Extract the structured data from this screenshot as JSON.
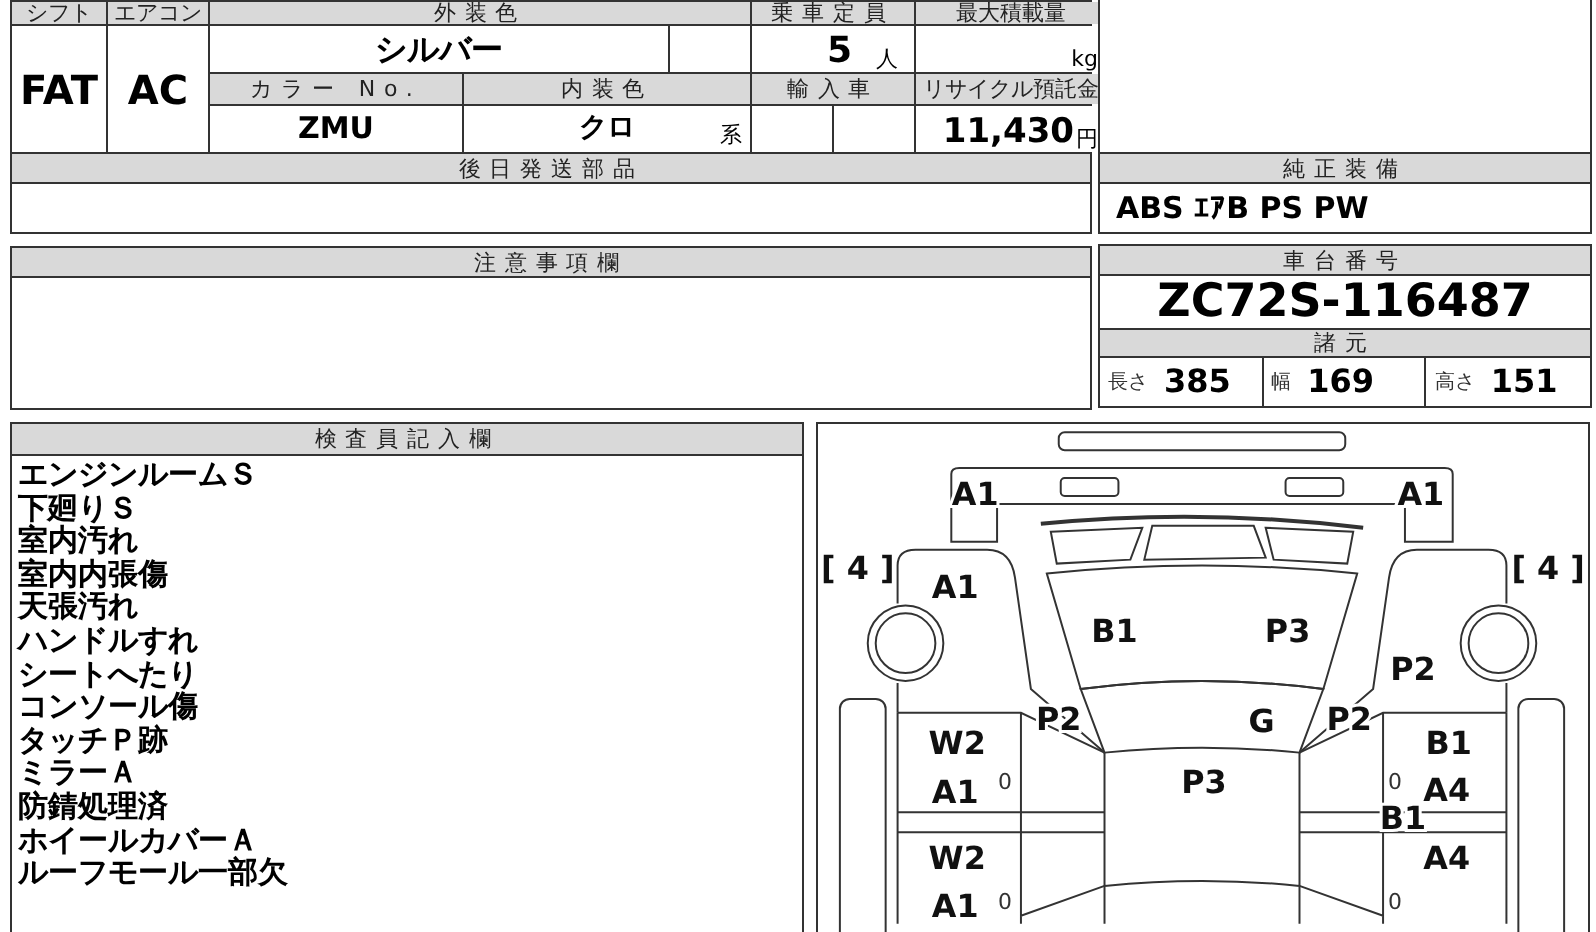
{
  "vehicle_table": {
    "shift": {
      "label": "シフト",
      "value": "FAT"
    },
    "aircon": {
      "label": "エアコン",
      "value": "AC"
    },
    "exterior_color": {
      "label": "外装色",
      "value": "シルバー"
    },
    "capacity": {
      "label": "乗車定員",
      "value": "5",
      "unit": "人"
    },
    "max_load": {
      "label": "最大積載量",
      "unit": "kg"
    },
    "color_no": {
      "label": "カラー No.",
      "value": "ZMU"
    },
    "interior_color": {
      "label": "内装色",
      "value": "クロ",
      "unit": "系"
    },
    "import": {
      "label": "輸入車"
    },
    "recycle_fee": {
      "label": "リサイクル預託金",
      "value": "11,430",
      "unit": "円"
    }
  },
  "later_parts": {
    "title": "後日発送部品"
  },
  "notes": {
    "title": "注意事項欄"
  },
  "equipment": {
    "title": "純正装備",
    "value": "ABS ｴｱB PS PW"
  },
  "chassis": {
    "title": "車台番号",
    "value": "ZC72S-116487"
  },
  "specs": {
    "title": "諸元",
    "items": [
      {
        "label": "長さ",
        "value": "385"
      },
      {
        "label": "幅",
        "value": "169"
      },
      {
        "label": "高さ",
        "value": "151"
      }
    ]
  },
  "inspector": {
    "title": "検査員記入欄",
    "lines": [
      "エンジンルームＳ",
      "下廻りＳ",
      "室内汚れ",
      "室内内張傷",
      "天張汚れ",
      "ハンドルすれ",
      "シートへたり",
      "コンソール傷",
      "タッチＰ跡",
      "ミラーＡ",
      "防錆処理済",
      "ホイールカバーＡ",
      "ルーフモール一部欠"
    ]
  },
  "damage_diagram": {
    "labels": [
      {
        "text": "A1",
        "kind": "code"
      },
      {
        "text": "A1",
        "kind": "code"
      },
      {
        "text": "[ 4 ]",
        "kind": "code"
      },
      {
        "text": "[ 4 ]",
        "kind": "code"
      },
      {
        "text": "A1",
        "kind": "code"
      },
      {
        "text": "B1",
        "kind": "code"
      },
      {
        "text": "P3",
        "kind": "code"
      },
      {
        "text": "P2",
        "kind": "code"
      },
      {
        "text": "P2",
        "kind": "code"
      },
      {
        "text": "G",
        "kind": "code"
      },
      {
        "text": "P2",
        "kind": "code"
      },
      {
        "text": "W2",
        "kind": "code"
      },
      {
        "text": "B1",
        "kind": "code"
      },
      {
        "text": "A1",
        "kind": "code"
      },
      {
        "text": "0",
        "kind": "mark"
      },
      {
        "text": "P3",
        "kind": "code"
      },
      {
        "text": "0",
        "kind": "mark"
      },
      {
        "text": "A4",
        "kind": "code"
      },
      {
        "text": "B1",
        "kind": "code"
      },
      {
        "text": "W2",
        "kind": "code"
      },
      {
        "text": "A4",
        "kind": "code"
      },
      {
        "text": "A1",
        "kind": "code"
      },
      {
        "text": "0",
        "kind": "mark"
      },
      {
        "text": "0",
        "kind": "mark"
      }
    ]
  }
}
